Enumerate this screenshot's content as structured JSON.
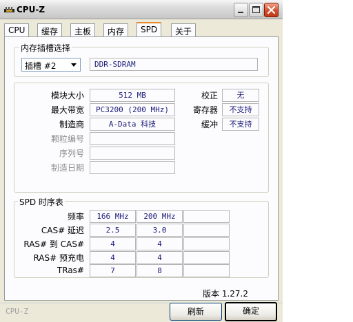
{
  "window": {
    "title": "CPU-Z"
  },
  "tabs": [
    {
      "label": "CPU"
    },
    {
      "label": "缓存"
    },
    {
      "label": "主板"
    },
    {
      "label": "内存"
    },
    {
      "label": "SPD"
    },
    {
      "label": "关于"
    }
  ],
  "slot_group": {
    "legend": "内存插槽选择",
    "slot_selected": "插槽 #2",
    "memory_type": "DDR-SDRAM"
  },
  "module": {
    "size_label": "模块大小",
    "size_value": "512 MB",
    "bandwidth_label": "最大带宽",
    "bandwidth_value": "PC3200 (200 MHz)",
    "manufacturer_label": "制造商",
    "manufacturer_value": "A-Data 科技",
    "part_label": "颗粒编号",
    "part_value": "",
    "serial_label": "序列号",
    "serial_value": "",
    "date_label": "制造日期",
    "date_value": "",
    "ecc_label": "校正",
    "ecc_value": "无",
    "registered_label": "寄存器",
    "registered_value": "不支持",
    "buffered_label": "缓冲",
    "buffered_value": "不支持"
  },
  "timings": {
    "legend": "SPD 时序表",
    "rows": [
      {
        "label": "频率",
        "values": [
          "166 MHz",
          "200 MHz",
          ""
        ]
      },
      {
        "label": "CAS# 延迟",
        "values": [
          "2.5",
          "3.0",
          ""
        ]
      },
      {
        "label": "RAS# 到 CAS#",
        "values": [
          "4",
          "4",
          ""
        ]
      },
      {
        "label": "RAS# 预充电",
        "values": [
          "4",
          "4",
          ""
        ]
      },
      {
        "label": "TRas#",
        "values": [
          "7",
          "8",
          ""
        ]
      }
    ]
  },
  "footer": {
    "version": "版本 1.27.2",
    "brand": "CPU-Z",
    "refresh_label": "刷新",
    "ok_label": "确定"
  }
}
